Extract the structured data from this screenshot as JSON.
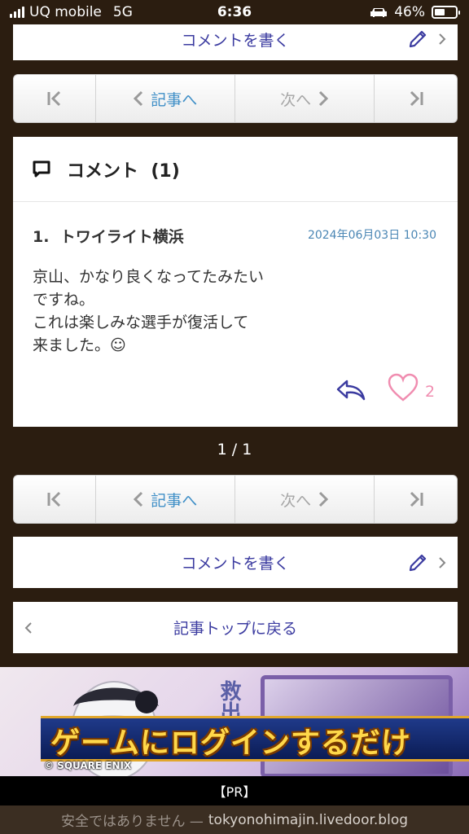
{
  "status_bar": {
    "carrier": "UQ mobile",
    "network": "5G",
    "time": "6:36",
    "battery": "46%"
  },
  "top_write": {
    "label": "コメントを書く"
  },
  "pager_top": {
    "prev_label": "記事へ",
    "next_label": "次へ"
  },
  "comments": {
    "title": "コメント",
    "count": "(1)",
    "items": [
      {
        "number": "1.",
        "author": "トワイライト横浜",
        "date": "2024年06月03日 10:30",
        "lines": [
          "京山、かなり良くなってたみたい",
          "ですね。",
          "これは楽しみな選手が復活して",
          "来ました。☺"
        ],
        "likes": "2"
      }
    ]
  },
  "page_indicator": "1 / 1",
  "pager_bottom": {
    "prev_label": "記事へ",
    "next_label": "次へ"
  },
  "bottom_write": {
    "label": "コメントを書く"
  },
  "back": {
    "label": "記事トップに戻る"
  },
  "ad": {
    "banner_text": "ゲームにログインするだけ",
    "side_kanji": "救出さ",
    "copyright": "© SQUARE ENIX"
  },
  "pr_label": "【PR】",
  "url_bar": {
    "warning": "安全ではありません —",
    "domain": "tokyonohimajin.livedoor.blog"
  },
  "colors": {
    "link": "#3b3ba0",
    "accent_blue": "#3f8fc7",
    "like_pink": "#f08db0",
    "background": "#2b1d10"
  }
}
